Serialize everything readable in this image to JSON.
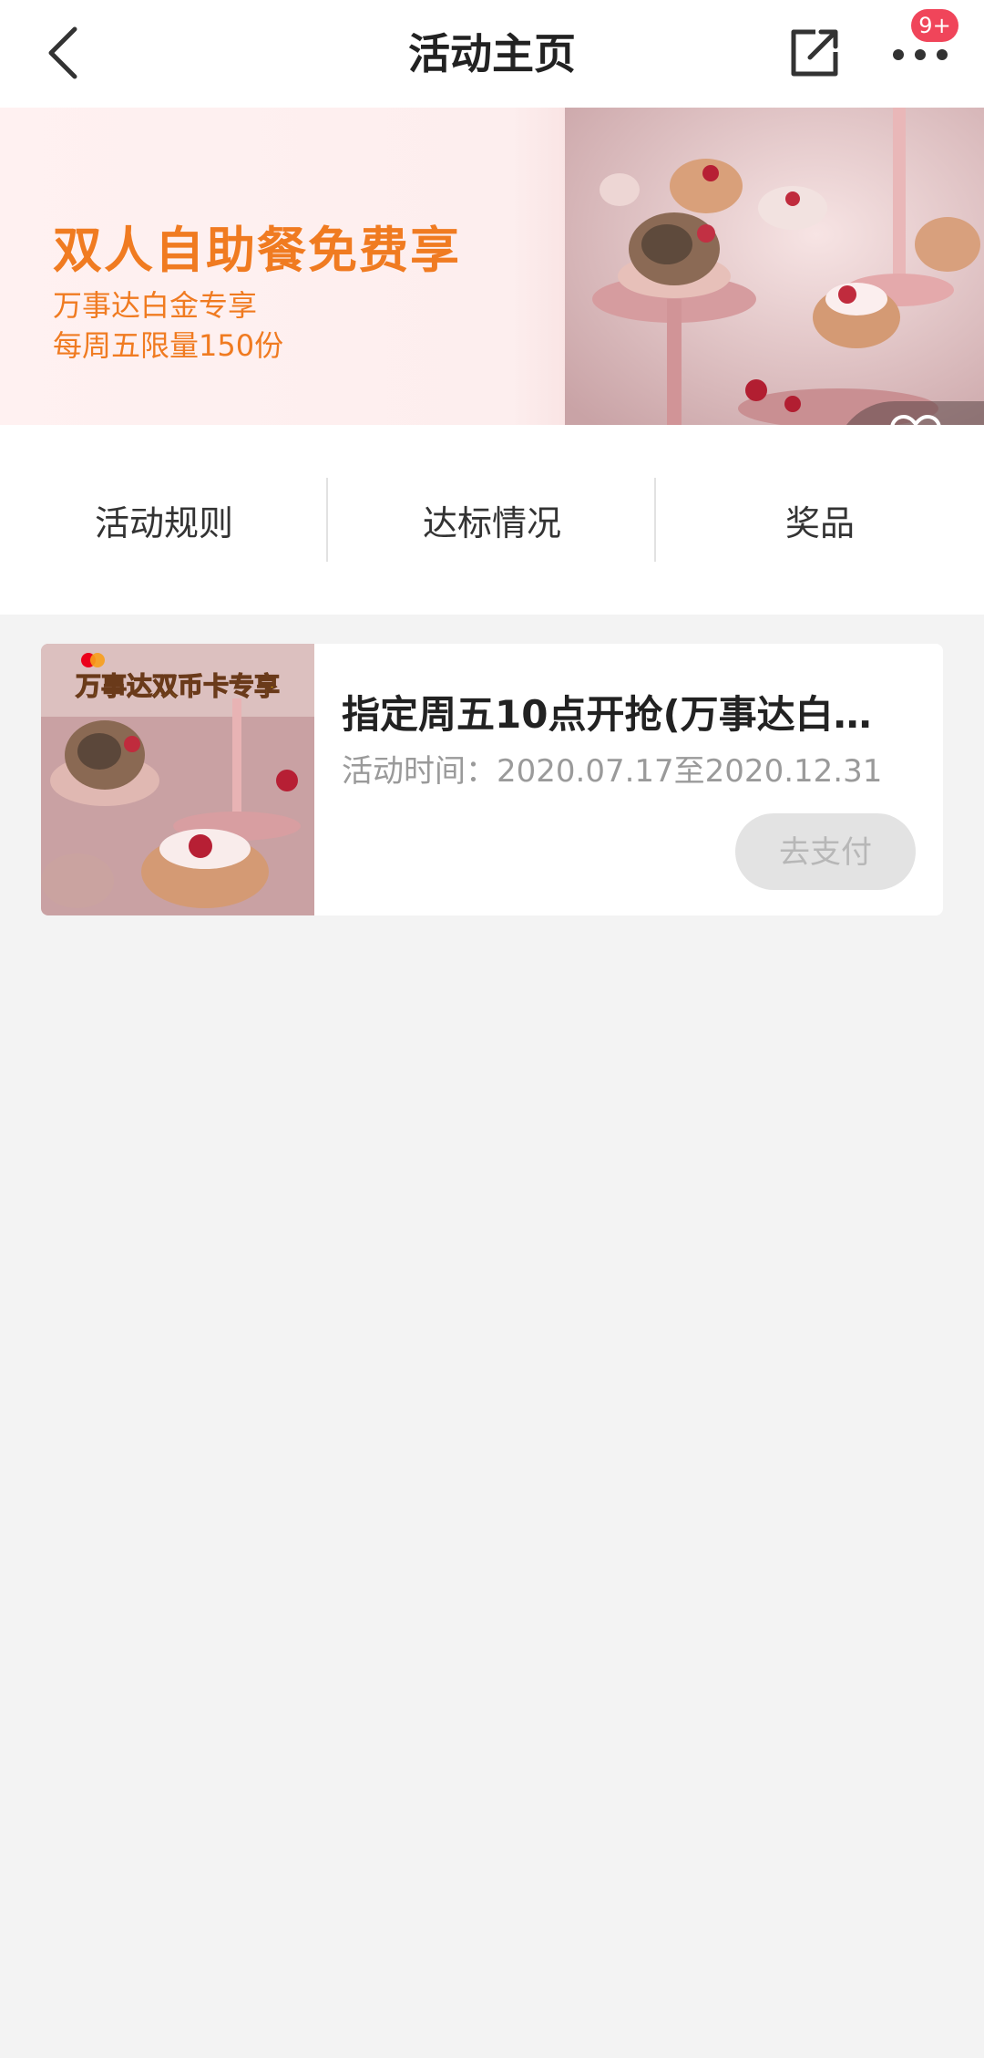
{
  "header": {
    "title": "活动主页",
    "badge": "9+",
    "icons": {
      "back": "back-chevron-icon",
      "share": "share-icon",
      "more": "more-dots-icon"
    }
  },
  "banner": {
    "title": "双人自助餐免费享",
    "subtitle_line1": "万事达白金专享",
    "subtitle_line2": "每周五限量150份",
    "favorite_label": "收藏",
    "accent_color": "#f07b21"
  },
  "tabs": [
    {
      "label": "活动规则"
    },
    {
      "label": "达标情况"
    },
    {
      "label": "奖品"
    }
  ],
  "card": {
    "image_caption": "万事达双币卡专享",
    "title": "指定周五10点开抢(万事达白…",
    "time": "活动时间：2020.07.17至2020.12.31",
    "button_label": "去支付"
  }
}
